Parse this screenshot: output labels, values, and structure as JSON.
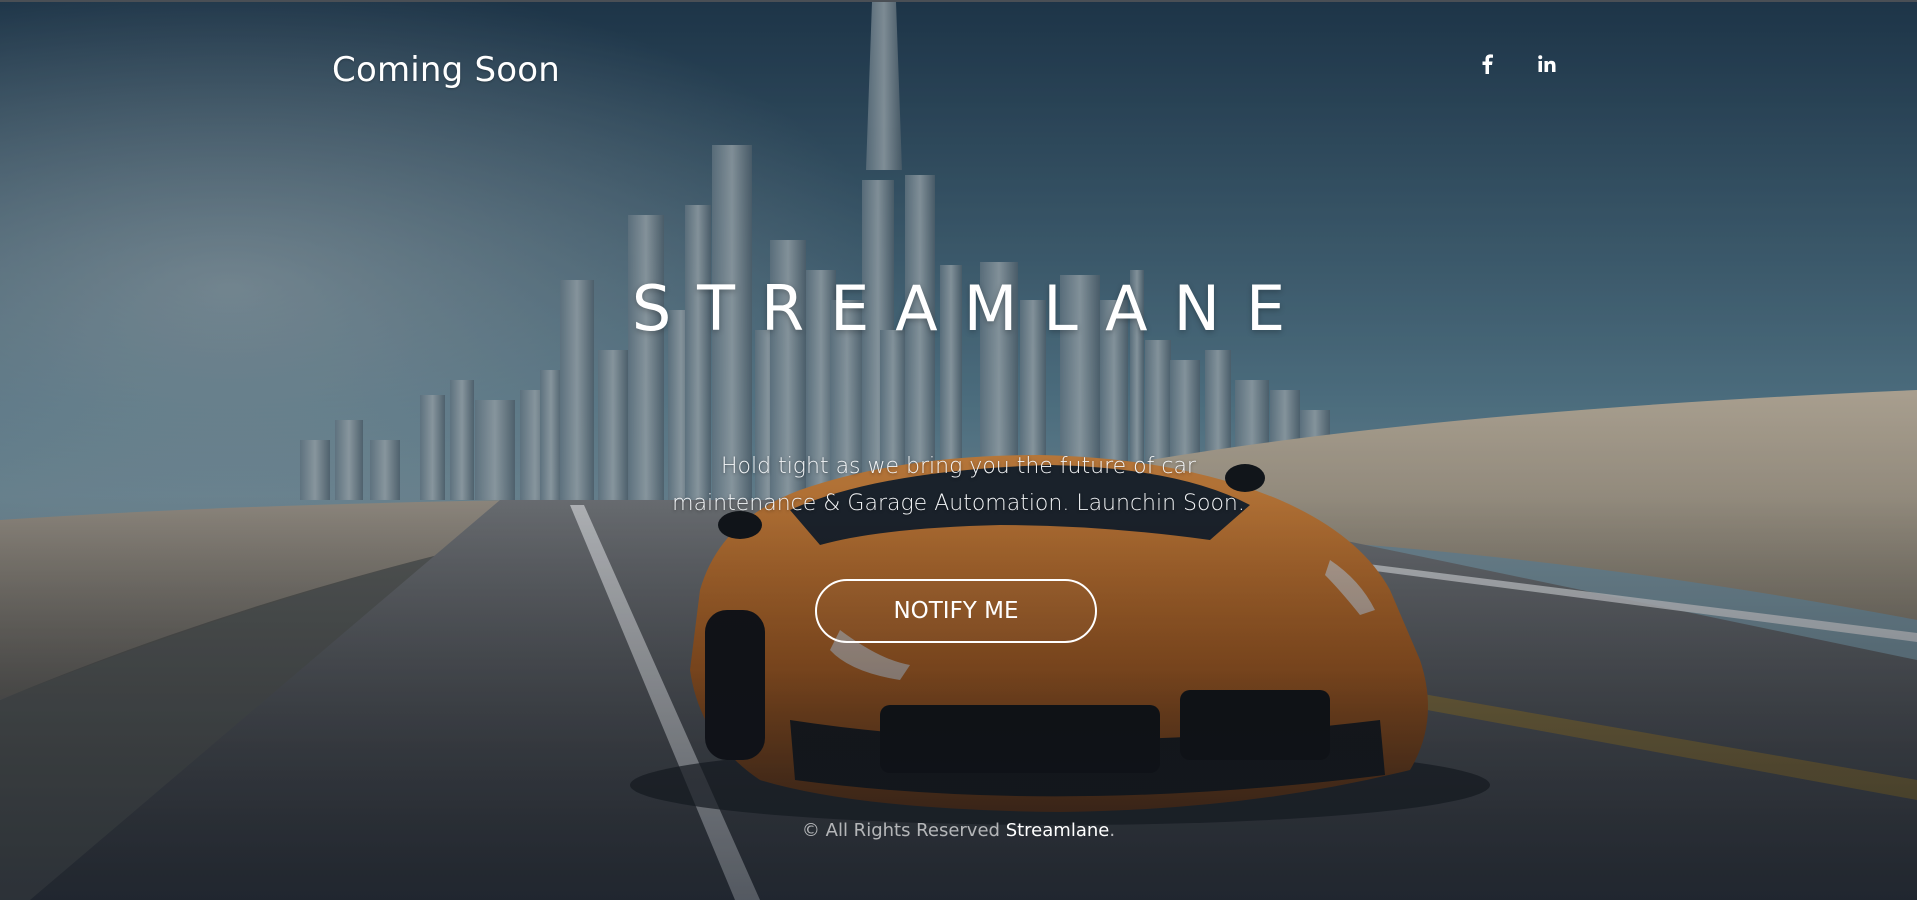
{
  "header": {
    "title": "Coming Soon",
    "social": [
      {
        "name": "facebook-icon",
        "glyph": "f"
      },
      {
        "name": "linkedin-icon",
        "glyph": "in"
      }
    ]
  },
  "hero": {
    "headline": "STREAMLANE",
    "tagline_line1": "Hold tight as we bring you the future of car",
    "tagline_line2": "maintenance & Garage Automation. Launchin Soon.",
    "button_label": "NOTIFY ME"
  },
  "footer": {
    "copyright": "© All Rights Reserved",
    "brand": "Streamlane",
    "suffix": "."
  },
  "colors": {
    "text": "#ffffff",
    "sky_top": "#1f3a4f",
    "sky_mid": "#5f8596",
    "car": "#c7742c",
    "sand": "#b8ab97",
    "road": "#5d6268"
  }
}
